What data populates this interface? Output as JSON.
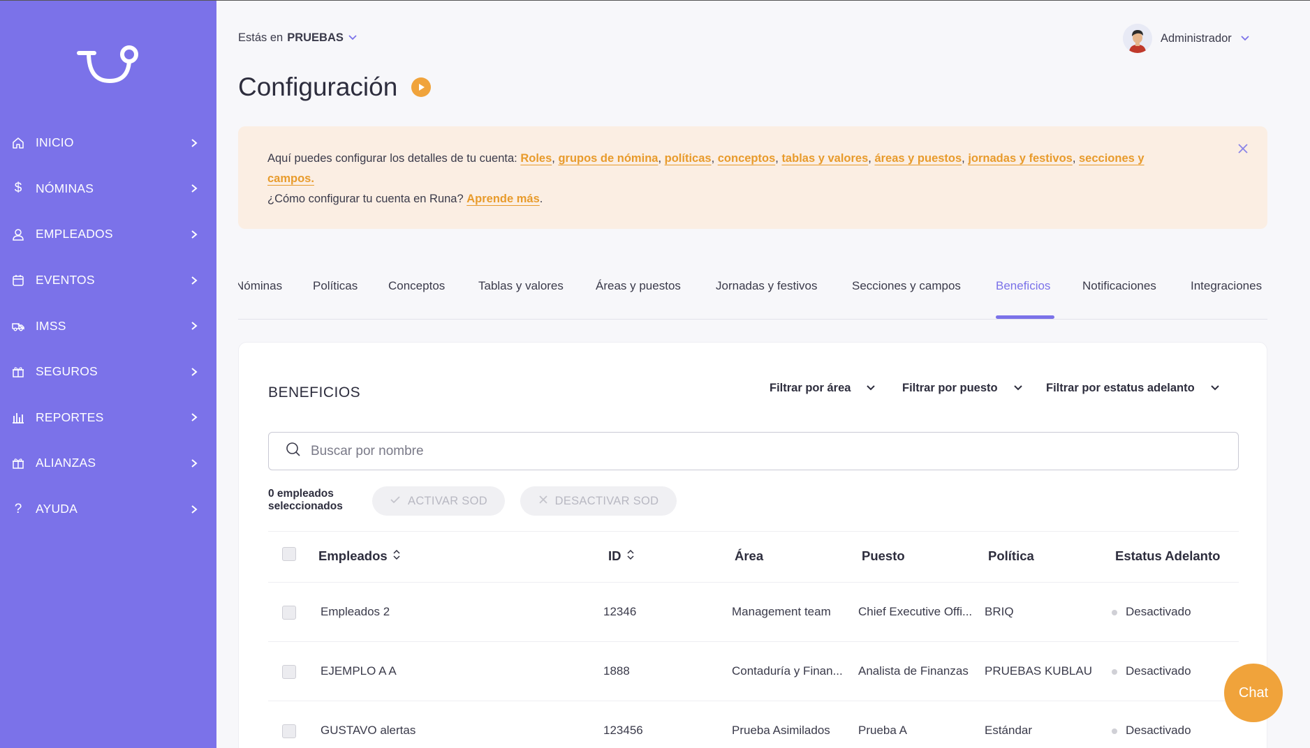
{
  "sidebar": {
    "items": [
      {
        "label": "INICIO",
        "icon": "home-icon"
      },
      {
        "label": "NÓMINAS",
        "icon": "dollar-icon"
      },
      {
        "label": "EMPLEADOS",
        "icon": "user-icon"
      },
      {
        "label": "EVENTOS",
        "icon": "calendar-icon"
      },
      {
        "label": "IMSS",
        "icon": "ambulance-icon"
      },
      {
        "label": "SEGUROS",
        "icon": "gift-icon"
      },
      {
        "label": "REPORTES",
        "icon": "chart-icon"
      },
      {
        "label": "ALIANZAS",
        "icon": "gift-icon"
      },
      {
        "label": "AYUDA",
        "icon": "question-icon"
      }
    ],
    "bg_color": "#7b72e9"
  },
  "header": {
    "env_prefix": "Estás en",
    "env_name": "PRUEBAS",
    "user_name": "Administrador"
  },
  "page": {
    "title": "Configuración"
  },
  "notice": {
    "intro": "Aquí puedes configurar los detalles de tu cuenta: ",
    "links": [
      "Roles",
      "grupos de nómina",
      "políticas",
      "conceptos",
      "tablas y valores",
      "áreas y puestos",
      "jornadas y festivos",
      "secciones y campos."
    ],
    "question": "¿Cómo configurar tu cuenta en Runa? ",
    "learn_more": "Aprende más",
    "learn_more_suffix": "."
  },
  "tabs": [
    {
      "label": "Nóminas"
    },
    {
      "label": "Políticas"
    },
    {
      "label": "Conceptos"
    },
    {
      "label": "Tablas y valores"
    },
    {
      "label": "Áreas y puestos"
    },
    {
      "label": "Jornadas y festivos"
    },
    {
      "label": "Secciones y campos"
    },
    {
      "label": "Beneficios",
      "active": true
    },
    {
      "label": "Notificaciones"
    },
    {
      "label": "Integraciones"
    }
  ],
  "benefits": {
    "title": "BENEFICIOS",
    "filters": [
      "Filtrar por área",
      "Filtrar por puesto",
      "Filtrar por estatus adelanto"
    ],
    "search_placeholder": "Buscar por nombre",
    "selected_count": "0 empleados seleccionados",
    "activate_label": "ACTIVAR SOD",
    "deactivate_label": "DESACTIVAR SOD",
    "columns": [
      "Empleados",
      "ID",
      "Área",
      "Puesto",
      "Política",
      "Estatus Adelanto"
    ],
    "rows": [
      {
        "name": "Empleados 2",
        "id": "12346",
        "area": "Management team",
        "puesto": "Chief Executive Offi...",
        "politica": "BRIQ",
        "estatus": "Desactivado"
      },
      {
        "name": "EJEMPLO A A",
        "id": "1888",
        "area": "Contaduría y Finan...",
        "puesto": "Analista de Finanzas",
        "politica": "PRUEBAS KUBLAU",
        "estatus": "Desactivado"
      },
      {
        "name": "GUSTAVO alertas",
        "id": "123456",
        "area": "Prueba Asimilados",
        "puesto": "Prueba A",
        "politica": "Estándar",
        "estatus": "Desactivado"
      }
    ]
  },
  "chat": {
    "label": "Chat"
  },
  "colors": {
    "accent": "#7b72e9",
    "orange": "#f0a33b",
    "notice_bg": "#fbeee3"
  }
}
